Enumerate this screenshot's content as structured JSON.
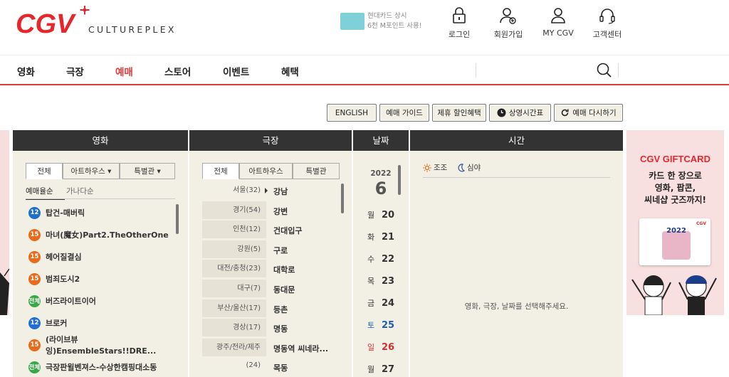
{
  "header": {
    "logo_text": "CGV",
    "logo_sub": "CULTUREPLEX",
    "promo_line1": "현대카드 상시",
    "promo_line2": "6천 M포인트 사용!",
    "links": [
      {
        "label": "로그인",
        "icon": "lock-icon"
      },
      {
        "label": "회원가입",
        "icon": "user-plus-icon"
      },
      {
        "label": "MY CGV",
        "icon": "user-icon"
      },
      {
        "label": "고객센터",
        "icon": "headset-icon"
      }
    ]
  },
  "nav": {
    "items": [
      "영화",
      "극장",
      "예매",
      "스토어",
      "이벤트",
      "혜택"
    ],
    "active": "예매",
    "active_color": "#e23a3a"
  },
  "toolbar": {
    "english": "ENGLISH",
    "guide": "예매 가이드",
    "discount": "제휴 할인혜택",
    "schedule": "상영시간표",
    "restart": "예매 다시하기"
  },
  "movie": {
    "header": "영화",
    "tabs": [
      "전체",
      "아트하우스 ▾",
      "특별관 ▾"
    ],
    "sort": [
      "예매율순",
      "가나다순"
    ],
    "items": [
      {
        "rating": "12",
        "color": "#1e6fd0",
        "title": "탑건-매버릭"
      },
      {
        "rating": "15",
        "color": "#e86a1a",
        "title": "마녀(魔女)Part2.TheOtherOne"
      },
      {
        "rating": "15",
        "color": "#e86a1a",
        "title": "헤어질결심"
      },
      {
        "rating": "15",
        "color": "#e86a1a",
        "title": "범죄도시2"
      },
      {
        "rating": "전체",
        "color": "#3aa64a",
        "title": "버즈라이트이어"
      },
      {
        "rating": "12",
        "color": "#1e6fd0",
        "title": "브로커"
      },
      {
        "rating": "15",
        "color": "#e86a1a",
        "title": "(라이브뷰잉)EnsembleStars!!DRE..."
      },
      {
        "rating": "전체",
        "color": "#3aa64a",
        "title": "극장판윌벤져스-수상한캠핑대소동"
      }
    ]
  },
  "theater": {
    "header": "극장",
    "tabs": [
      "전체",
      "아트하우스",
      "특별관"
    ],
    "regions": [
      "서울(32)",
      "경기(54)",
      "인천(12)",
      "강원(5)",
      "대전/충청(23)",
      "대구(7)",
      "부산/울산(17)",
      "경상(17)",
      "광주/전라/제주(24)"
    ],
    "branches": [
      "강남",
      "강변",
      "건대입구",
      "구로",
      "대학로",
      "동대문",
      "등촌",
      "명동",
      "명동역 씨네라...",
      "목동"
    ]
  },
  "date": {
    "header": "날짜",
    "year": "2022",
    "month": "6",
    "days": [
      {
        "w": "월",
        "d": "20",
        "color": "#333"
      },
      {
        "w": "화",
        "d": "21",
        "color": "#333"
      },
      {
        "w": "수",
        "d": "22",
        "color": "#333"
      },
      {
        "w": "목",
        "d": "23",
        "color": "#333"
      },
      {
        "w": "금",
        "d": "24",
        "color": "#333"
      },
      {
        "w": "토",
        "d": "25",
        "color": "#1e5bb8"
      },
      {
        "w": "일",
        "d": "26",
        "color": "#d23030"
      },
      {
        "w": "월",
        "d": "27",
        "color": "#333"
      }
    ]
  },
  "time": {
    "header": "시간",
    "morning": "조조",
    "night": "심야",
    "message": "영화, 극장, 날짜를 선택해주세요."
  },
  "banner": {
    "title": "CGV GIFTCARD",
    "line1": "카드 한 장으로",
    "line2": "영화, 팝콘,",
    "line3": "씨네샵 굿즈까지!",
    "card_year": "2022"
  }
}
